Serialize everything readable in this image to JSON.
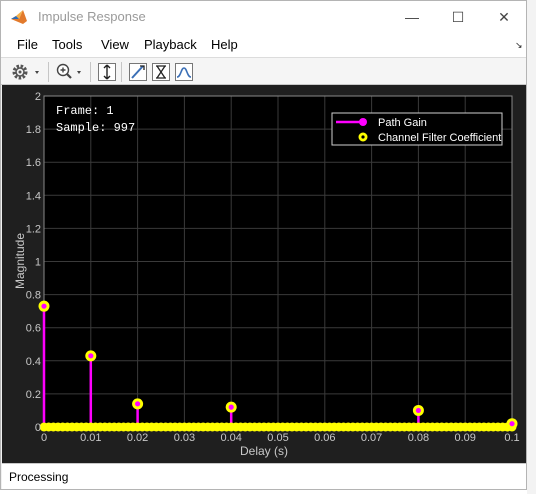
{
  "window": {
    "title": "Impulse Response",
    "controls": {
      "minimize": "—",
      "maximize": "☐",
      "close": "✕"
    }
  },
  "menu": [
    "File",
    "Tools",
    "View",
    "Playback",
    "Help"
  ],
  "toolbar": {
    "icons": [
      "gear-icon",
      "zoom-in-icon",
      "scale-axes-icon",
      "data-cursor-icon",
      "trigger-icon",
      "measurement-icon"
    ]
  },
  "annotation": {
    "frame": "Frame: 1",
    "sample": "Sample: 997"
  },
  "status": "Processing",
  "colors": {
    "background": "#000000",
    "grid": "#3a3a3a",
    "path_gain": "#ff00ff",
    "filter_coefficient": "#ffff00",
    "axis_text": "#c8c8c8"
  },
  "chart_data": {
    "type": "stem",
    "xlabel": "Delay (s)",
    "ylabel": "Magnitude",
    "xlim": [
      0,
      0.1
    ],
    "ylim": [
      0,
      2
    ],
    "xticks": [
      0,
      0.01,
      0.02,
      0.03,
      0.04,
      0.05,
      0.06,
      0.07,
      0.08,
      0.09,
      0.1
    ],
    "xtick_labels": [
      "0",
      "0.01",
      "0.02",
      "0.03",
      "0.04",
      "0.05",
      "0.06",
      "0.07",
      "0.08",
      "0.09",
      "0.1"
    ],
    "yticks": [
      0,
      0.2,
      0.4,
      0.6,
      0.8,
      1,
      1.2,
      1.4,
      1.6,
      1.8,
      2
    ],
    "ytick_labels": [
      "0",
      "0.2",
      "0.4",
      "0.6",
      "0.8",
      "1",
      "1.2",
      "1.4",
      "1.6",
      "1.8",
      "2"
    ],
    "grid": true,
    "legend_position": "top-right",
    "series": [
      {
        "name": "Path Gain",
        "x": [
          0,
          0.01,
          0.02,
          0.04,
          0.08,
          0.1
        ],
        "y": [
          0.73,
          0.43,
          0.14,
          0.12,
          0.1,
          0.02
        ]
      },
      {
        "name": "Channel Filter Coefficient",
        "x": [
          0,
          0.01,
          0.02,
          0.04,
          0.08,
          0.1
        ],
        "y": [
          0.73,
          0.43,
          0.14,
          0.12,
          0.1,
          0.02
        ],
        "zero_samples_x_range": [
          0,
          0.1
        ],
        "zero_samples_count": 101
      }
    ]
  }
}
